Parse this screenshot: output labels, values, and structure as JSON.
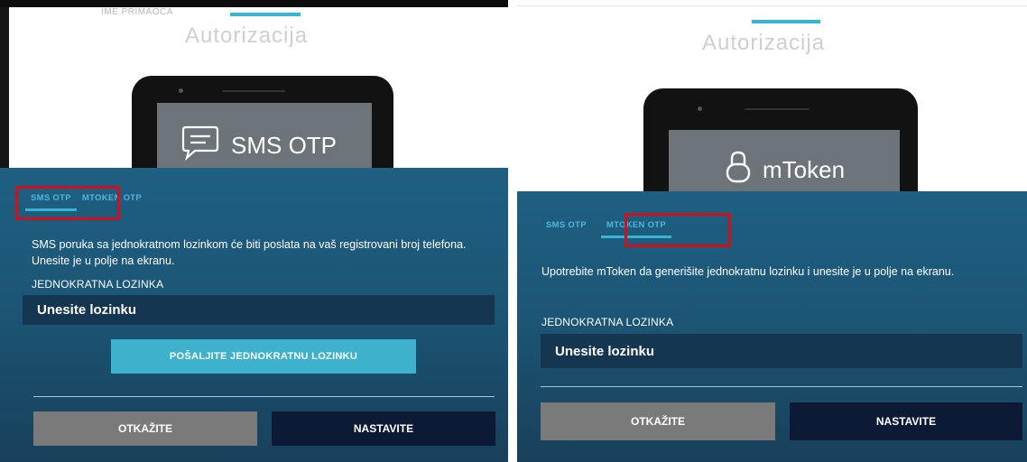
{
  "left": {
    "faded_top_label": "IME PRIMAOCA",
    "title": "Autorizacija",
    "phone_screen_label": "SMS OTP",
    "phone_icon": "chat-bubble-icon",
    "tabs": [
      {
        "label": "SMS OTP",
        "active": true
      },
      {
        "label": "MTOKEN OTP",
        "active": false
      }
    ],
    "description": "SMS poruka sa jednokratnom lozinkom će biti poslata na vaš registrovani broj telefona. Unesite je u polje na ekranu.",
    "field_label": "JEDNOKRATNA LOZINKA",
    "input_value": "Unesite lozinku",
    "send_button": "POŠALJITE JEDNOKRATNU LOZINKU",
    "cancel_button": "OTKAŽITE",
    "continue_button": "NASTAVITE"
  },
  "right": {
    "title": "Autorizacija",
    "phone_screen_label": "mToken",
    "phone_icon": "lock-icon",
    "tabs": [
      {
        "label": "SMS OTP",
        "active": false
      },
      {
        "label": "MTOKEN OTP",
        "active": true
      }
    ],
    "description": "Upotrebite mToken da generišite jednokratnu lozinku i unesite je u polje na ekranu.",
    "field_label": "JEDNOKRATNA LOZINKA",
    "input_value": "Unesite lozinku",
    "cancel_button": "OTKAŽITE",
    "continue_button": "NASTAVITE"
  },
  "colors": {
    "accent": "#3ab4d6",
    "highlight_box": "#d2101c",
    "panel_dark": "#1c5676",
    "continue_bg": "#0c1a35",
    "cancel_bg": "#7a7a7a"
  }
}
